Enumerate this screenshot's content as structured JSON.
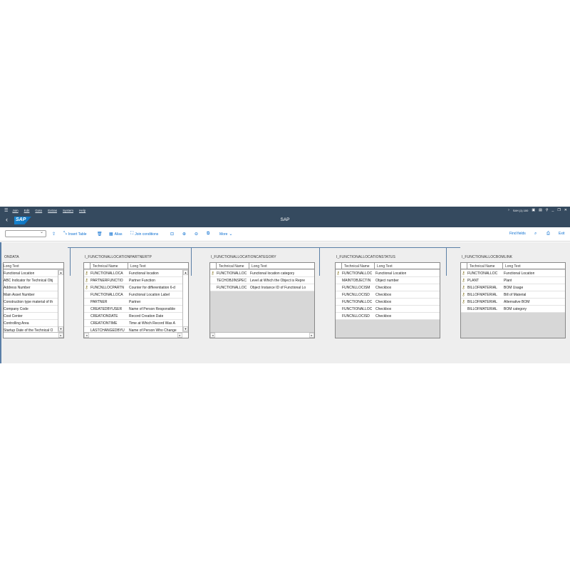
{
  "menu": {
    "items": [
      "Join",
      "Edit",
      "Goto",
      "Extras",
      "System",
      "Help"
    ],
    "system_info": "S4H (1) 100"
  },
  "shell": {
    "title": "SAP",
    "logo": "SAP"
  },
  "toolbar": {
    "insert_table": "Insert Table",
    "alias": "Alias",
    "join_conditions": "Join conditions",
    "more": "More",
    "find_fields": "Find fields",
    "exit": "Exit"
  },
  "tables": [
    {
      "name": "ONDATA",
      "col1": "",
      "col2": "Long Text",
      "rows": [
        {
          "key": false,
          "tech": "",
          "text": "Functional Location"
        },
        {
          "key": false,
          "tech": "",
          "text": "ABC Indicator for Technical Obj"
        },
        {
          "key": false,
          "tech": "",
          "text": "Address Number"
        },
        {
          "key": false,
          "tech": "",
          "text": "Main Asset Number"
        },
        {
          "key": false,
          "tech": "",
          "text": "Construction type material of th"
        },
        {
          "key": false,
          "tech": "",
          "text": "Company Code"
        },
        {
          "key": false,
          "tech": "",
          "text": "Cost Center"
        },
        {
          "key": false,
          "tech": "",
          "text": "Controlling Area"
        },
        {
          "key": false,
          "tech": "",
          "text": "Startup Date of the Technical O"
        }
      ]
    },
    {
      "name": "I_FUNCTIONALLOCATIONPARTNERTP",
      "col1": "Technical Name",
      "col2": "Long Text",
      "rows": [
        {
          "key": true,
          "tech": "FUNCTIONALLOCA",
          "text": "Functional location"
        },
        {
          "key": true,
          "tech": "PARTNERFUNCTIO",
          "text": "Partner Function"
        },
        {
          "key": true,
          "tech": "FUNCNLLOCPARTN",
          "text": "Counter for differentiation 6-d"
        },
        {
          "key": false,
          "tech": "FUNCTIONALLOCA",
          "text": "Functional Location Label"
        },
        {
          "key": false,
          "tech": "PARTNER",
          "text": "Partner"
        },
        {
          "key": false,
          "tech": "CREATEDBYUSER",
          "text": "Name of Person Responsible"
        },
        {
          "key": false,
          "tech": "CREATIONDATE",
          "text": "Record Creation Date"
        },
        {
          "key": false,
          "tech": "CREATIONTIME",
          "text": "Time at Which Record Was A"
        },
        {
          "key": false,
          "tech": "LASTCHANGEDBYU",
          "text": "Name of Person Who Change"
        }
      ]
    },
    {
      "name": "I_FUNCTIONALLOCATIONCATEGORY",
      "col1": "Technical Name",
      "col2": "Long Text",
      "rows": [
        {
          "key": true,
          "tech": "FUNCTIONALLOC",
          "text": "Functional location category"
        },
        {
          "key": false,
          "tech": "TECHOBJINSPEC",
          "text": "Level at Which the Object is Repre"
        },
        {
          "key": false,
          "tech": "FUNCTIONALLOC",
          "text": "Object Instance ID of Functional Lo"
        }
      ]
    },
    {
      "name": "I_FUNCTIONALLOCATIONSTATUS",
      "col1": "Technical Name",
      "col2": "Long Text",
      "rows": [
        {
          "key": true,
          "tech": "FUNCTIONALLOC",
          "text": "Functional Location"
        },
        {
          "key": false,
          "tech": "MAINTOBJECTIN",
          "text": "Object number"
        },
        {
          "key": false,
          "tech": "FUNCNLLOCISM",
          "text": "Checkbox"
        },
        {
          "key": false,
          "tech": "FUNCNLLOCISD",
          "text": "Checkbox"
        },
        {
          "key": false,
          "tech": "FUNCTIONALLOC",
          "text": "Checkbox"
        },
        {
          "key": false,
          "tech": "FUNCTIONALLOC",
          "text": "Checkbox"
        },
        {
          "key": false,
          "tech": "FUNCNLLOCISD",
          "text": "Checkbox"
        }
      ]
    },
    {
      "name": "I_FUNCTIONALLOCBOMLINK",
      "col1": "Technical Name",
      "col2": "Long Text",
      "rows": [
        {
          "key": true,
          "tech": "FUNCTIONALLOC",
          "text": "Functional Location"
        },
        {
          "key": true,
          "tech": "PLANT",
          "text": "Plant"
        },
        {
          "key": true,
          "tech": "BILLOFMATERIAL",
          "text": "BOM Usage"
        },
        {
          "key": true,
          "tech": "BILLOFMATERIAL",
          "text": "Bill of Material"
        },
        {
          "key": true,
          "tech": "BILLOFMATERIAL",
          "text": "Alternative BOM"
        },
        {
          "key": false,
          "tech": "BILLOFMATERIAL",
          "text": "BOM category"
        }
      ]
    }
  ]
}
